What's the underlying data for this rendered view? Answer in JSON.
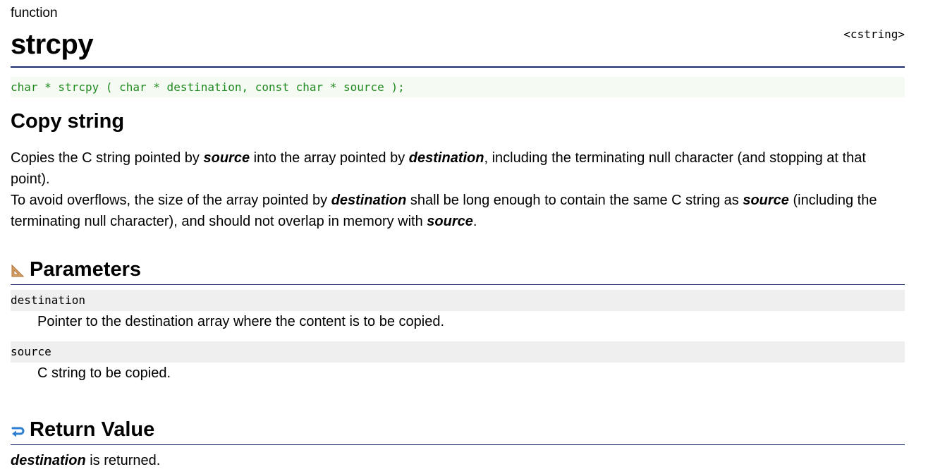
{
  "header": {
    "kind": "function",
    "title": "strcpy",
    "header_file": "<cstring>"
  },
  "prototype": "char * strcpy ( char * destination, const char * source );",
  "description": {
    "title": "Copy string",
    "p1": {
      "t1": "Copies the C string pointed by ",
      "b1": "source",
      "t2": " into the array pointed by ",
      "b2": "destination",
      "t3": ", including the terminating null character (and stopping at that point)."
    },
    "p2": {
      "t1": "To avoid overflows, the size of the array pointed by ",
      "b1": "destination",
      "t2": " shall be long enough to contain the same C string as ",
      "b2": "source",
      "t3": " (including the terminating null character), and should not overlap in memory with ",
      "b3": "source",
      "t4": "."
    }
  },
  "parameters": {
    "title": "Parameters",
    "icon": "set-square-icon",
    "items": [
      {
        "name": "destination",
        "desc": "Pointer to the destination array where the content is to be copied."
      },
      {
        "name": "source",
        "desc": "C string to be copied."
      }
    ]
  },
  "return_value": {
    "title": "Return Value",
    "icon": "return-arrow-icon",
    "b1": "destination",
    "t1": " is returned."
  },
  "colors": {
    "rule": "#1c2c6b",
    "prototype_text": "#1f8a1f",
    "prototype_bg": "#f5fbf3",
    "param_bg": "#efefef",
    "icon_orange": "#d9a066",
    "icon_blue": "#2f7fd0"
  }
}
